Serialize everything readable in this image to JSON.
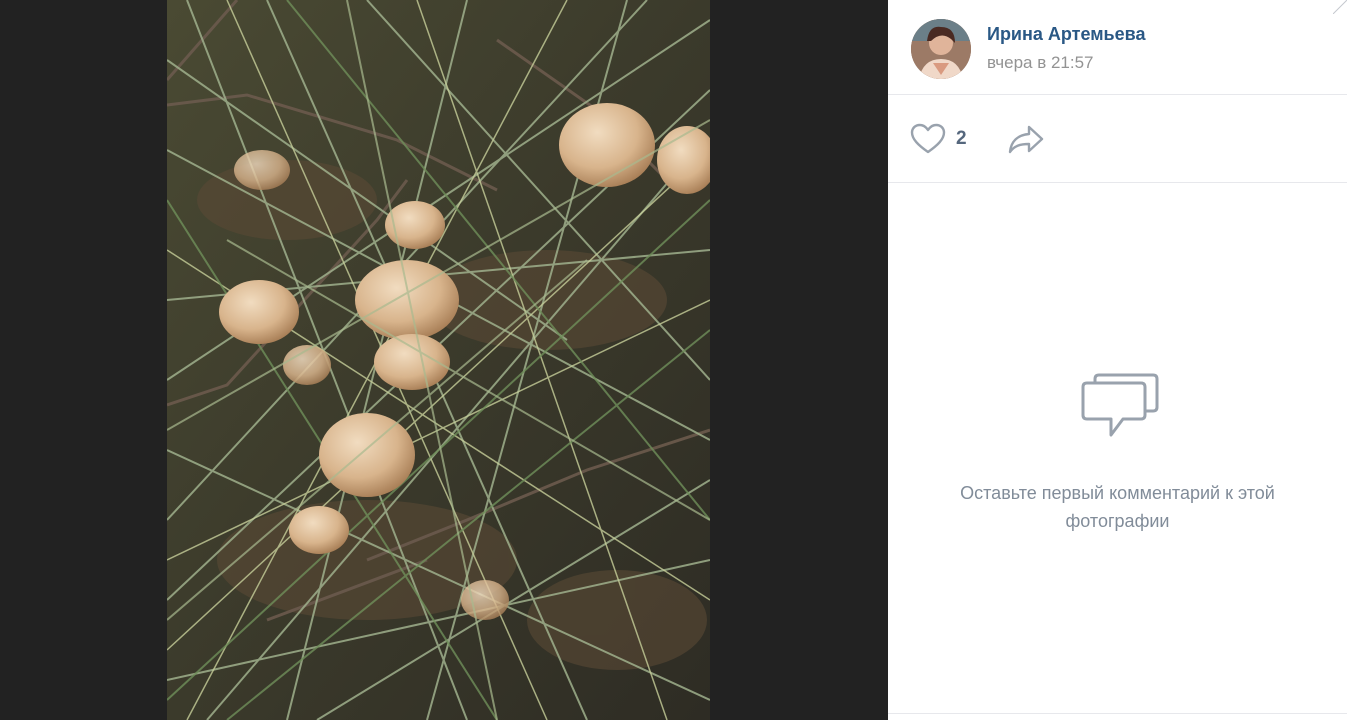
{
  "photo": {
    "subject": "mushrooms-in-grass-photo"
  },
  "author": {
    "name": "Ирина Артемьева",
    "time": "вчера в 21:57"
  },
  "actions": {
    "like_count": "2"
  },
  "comments": {
    "empty_message": "Оставьте первый комментарий к этой фотографии"
  },
  "colors": {
    "viewer_background": "#222222",
    "link": "#2a5885",
    "muted": "#939393",
    "icon": "#99a2ad"
  }
}
